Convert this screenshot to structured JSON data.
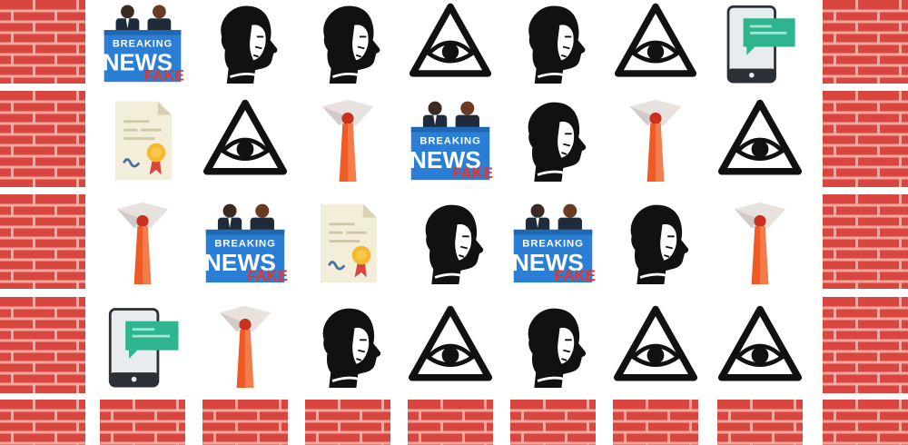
{
  "game": {
    "title": "",
    "board": {
      "columns": 9,
      "rows": 5,
      "grid": [
        [
          "brick-wall",
          "breaking-news-fake",
          "putin-profile",
          "putin-profile",
          "all-seeing-eye",
          "putin-profile",
          "all-seeing-eye",
          "smartphone-chat",
          "brick-wall"
        ],
        [
          "brick-wall",
          "certificate-document",
          "all-seeing-eye",
          "necktie",
          "breaking-news-fake",
          "putin-profile",
          "necktie",
          "all-seeing-eye",
          "brick-wall"
        ],
        [
          "brick-wall",
          "necktie",
          "breaking-news-fake",
          "certificate-document",
          "putin-profile",
          "breaking-news-fake",
          "putin-profile",
          "necktie",
          "brick-wall"
        ],
        [
          "brick-wall",
          "smartphone-chat",
          "necktie",
          "putin-profile",
          "all-seeing-eye",
          "putin-profile",
          "all-seeing-eye",
          "all-seeing-eye",
          "brick-wall"
        ],
        [
          "brick-wall",
          "brick-wall",
          "brick-wall",
          "brick-wall",
          "brick-wall",
          "brick-wall",
          "brick-wall",
          "brick-wall",
          "brick-wall"
        ]
      ]
    },
    "tile_text": {
      "breaking": "BREAKING",
      "news": "NEWS",
      "fake": "FAKE"
    },
    "colors": {
      "background": "#ffffff",
      "brick": "#d8463f",
      "brick_mortar": "#f4b0a8",
      "news_blue": "#2a7fd4",
      "fake_red": "#e8342a",
      "tie_orange": "#f05a24",
      "chat_green": "#2eb58f",
      "eye_black": "#111111"
    }
  }
}
